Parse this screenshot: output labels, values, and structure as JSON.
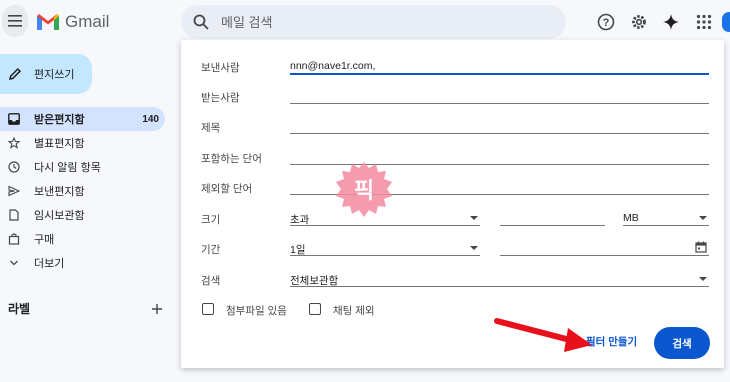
{
  "header": {
    "app_name": "Gmail",
    "search_placeholder": "메일 검색"
  },
  "sidebar": {
    "compose_label": "편지쓰기",
    "items": [
      {
        "label": "받은편지함",
        "count": "140",
        "active": true,
        "icon": "inbox-icon"
      },
      {
        "label": "별표편지함",
        "icon": "star-icon"
      },
      {
        "label": "다시 알림 항목",
        "icon": "clock-icon"
      },
      {
        "label": "보낸편지함",
        "icon": "send-icon"
      },
      {
        "label": "임시보관함",
        "icon": "draft-icon"
      },
      {
        "label": "구매",
        "icon": "shopping-bag-icon"
      },
      {
        "label": "더보기",
        "icon": "chevron-down-icon"
      }
    ],
    "labels_heading": "라벨"
  },
  "search_panel": {
    "from_label": "보낸사람",
    "from_value": "nnn@nave1r.com,",
    "to_label": "받는사람",
    "subject_label": "제목",
    "has_words_label": "포함하는 단어",
    "exclude_label": "제외할 단어",
    "size_label": "크기",
    "size_op": "초과",
    "size_unit": "MB",
    "date_label": "기간",
    "date_value": "1일",
    "search_in_label": "검색",
    "search_in_value": "전체보관함",
    "attachment_label": "첨부파일 있음",
    "exclude_chats_label": "채팅 제외",
    "create_filter_label": "필터 만들기",
    "search_button_label": "검색"
  },
  "watermark_text": "픽",
  "colors": {
    "accent": "#0b57d0",
    "compose_bg": "#c2e7ff",
    "active_nav_bg": "#d3e3fd",
    "arrow": "#e8101a",
    "stamp": "#f48aa0"
  }
}
